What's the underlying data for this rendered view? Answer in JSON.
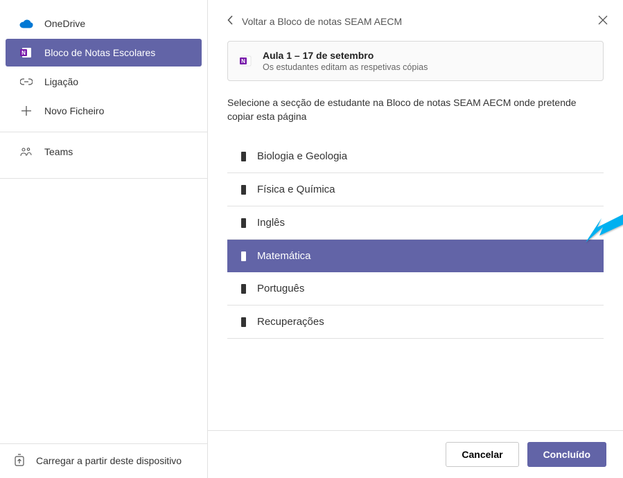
{
  "sidebar": {
    "items": [
      {
        "label": "OneDrive",
        "icon": "onedrive"
      },
      {
        "label": "Bloco de Notas Escolares",
        "icon": "onenote",
        "selected": true
      },
      {
        "label": "Ligação",
        "icon": "link"
      },
      {
        "label": "Novo Ficheiro",
        "icon": "plus"
      }
    ],
    "teams_label": "Teams",
    "footer_label": "Carregar a partir deste dispositivo"
  },
  "header": {
    "back_label": "Voltar a Bloco de notas SEAM AECM"
  },
  "card": {
    "title": "Aula 1 – 17 de setembro",
    "subtitle": "Os estudantes editam as respetivas cópias"
  },
  "instruction": "Selecione a secção de estudante na Bloco de notas SEAM AECM onde pretende copiar esta página",
  "sections": [
    {
      "label": "Biologia e Geologia"
    },
    {
      "label": "Física e Química"
    },
    {
      "label": "Inglês"
    },
    {
      "label": "Matemática",
      "selected": true
    },
    {
      "label": "Português"
    },
    {
      "label": "Recuperações"
    }
  ],
  "buttons": {
    "cancel": "Cancelar",
    "done": "Concluído"
  }
}
